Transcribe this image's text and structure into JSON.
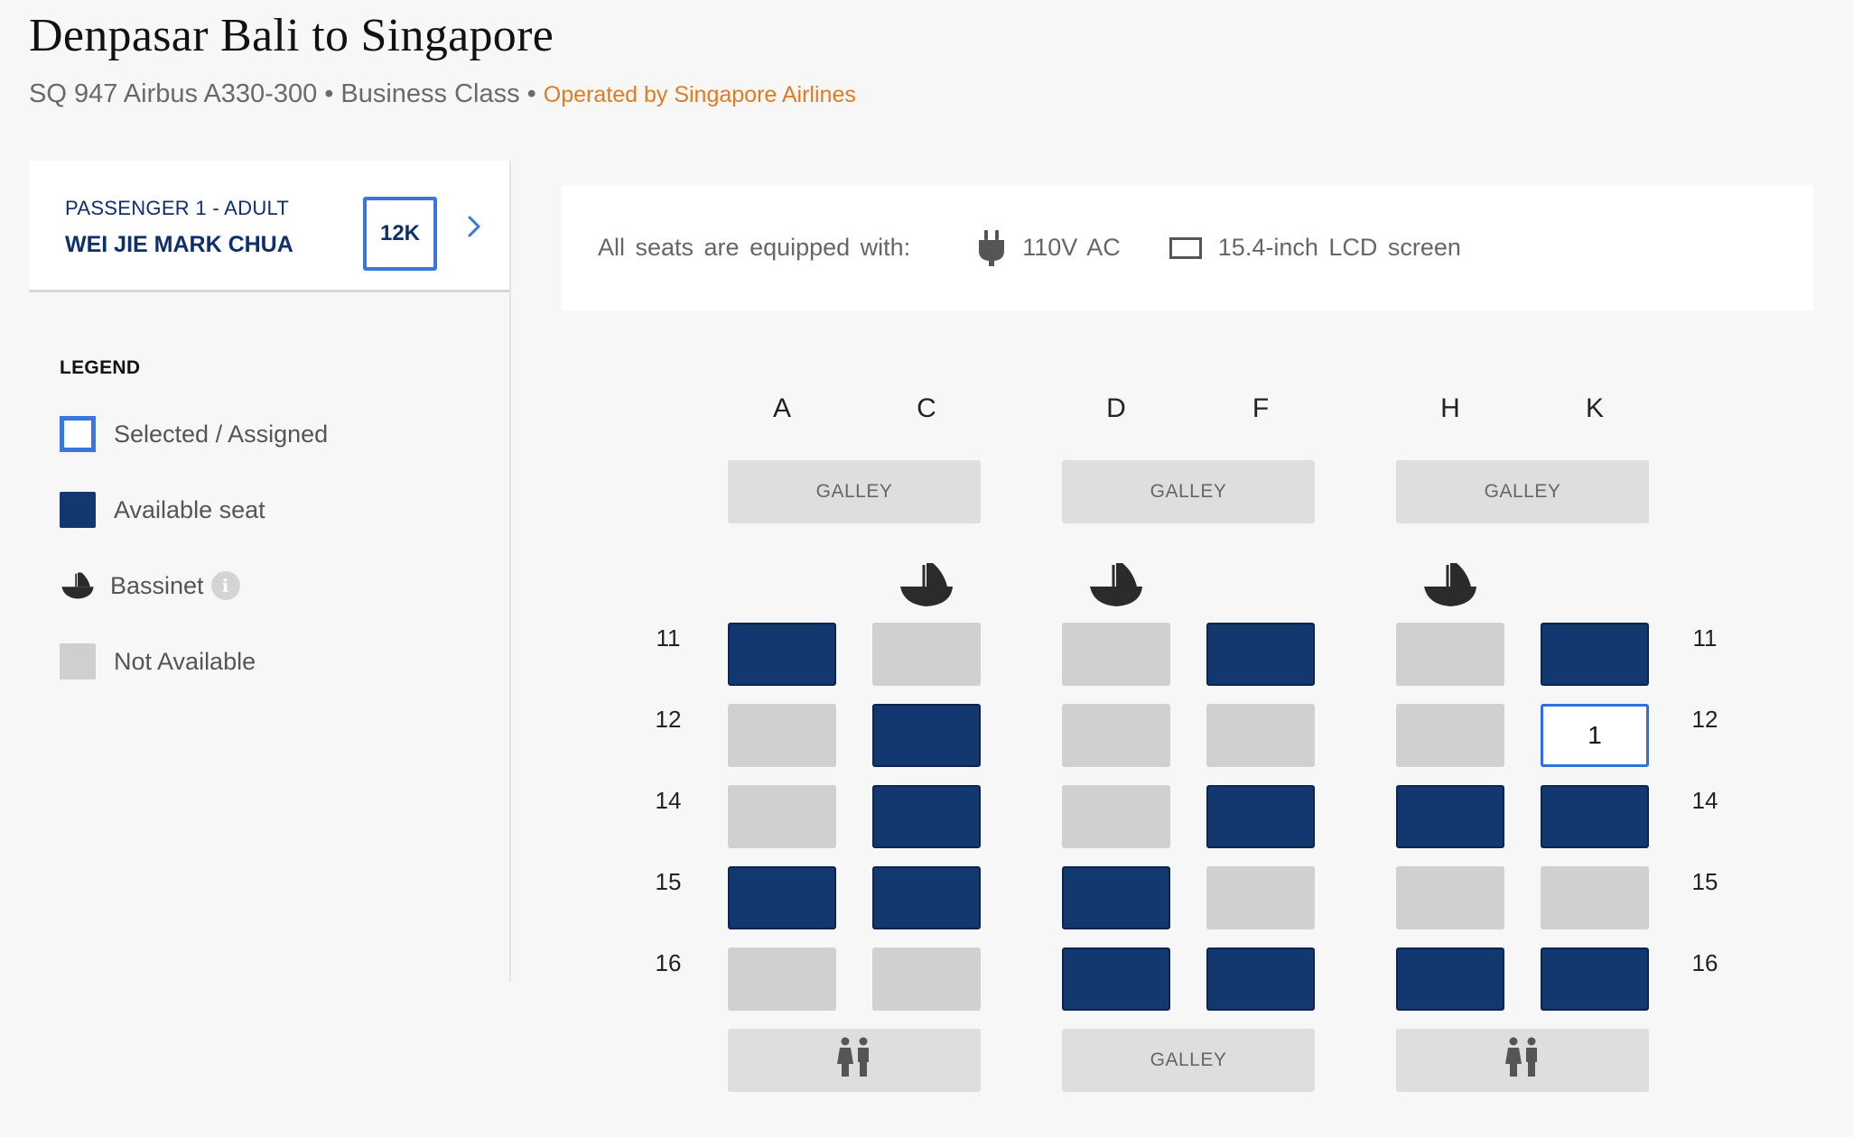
{
  "header": {
    "title": "Denpasar Bali to Singapore",
    "flight": "SQ 947 Airbus A330-300",
    "cabin": "Business Class",
    "separator": "•",
    "operated_by": "Operated by Singapore Airlines"
  },
  "passenger": {
    "label": "PASSENGER 1 - ADULT",
    "name": "WEI JIE MARK CHUA",
    "seat": "12K"
  },
  "legend": {
    "title": "LEGEND",
    "items": [
      {
        "label": "Selected / Assigned",
        "icon": "selected-swatch"
      },
      {
        "label": "Available seat",
        "icon": "available-swatch"
      },
      {
        "label": "Bassinet",
        "icon": "bassinet-icon"
      },
      {
        "label": "Not Available",
        "icon": "not-available-swatch"
      }
    ]
  },
  "amenities": {
    "lead": "All seats are equipped with:",
    "items": [
      {
        "label": "110V AC",
        "icon": "power-plug-icon"
      },
      {
        "label": "15.4-inch LCD screen",
        "icon": "screen-icon"
      }
    ]
  },
  "seatmap": {
    "columns": [
      "A",
      "C",
      "D",
      "F",
      "H",
      "K"
    ],
    "front_facilities": [
      "GALLEY",
      "GALLEY",
      "GALLEY"
    ],
    "rear_facilities": [
      {
        "label": "",
        "icon": "lavatory-icon"
      },
      {
        "label": "GALLEY",
        "icon": ""
      },
      {
        "label": "",
        "icon": "lavatory-icon"
      }
    ],
    "bassinet_columns": [
      "C",
      "D",
      "H"
    ],
    "rows": [
      {
        "number": "11",
        "seats": [
          "available",
          "not-available",
          "not-available",
          "available",
          "not-available",
          "available"
        ]
      },
      {
        "number": "12",
        "seats": [
          "not-available",
          "available",
          "not-available",
          "not-available",
          "not-available",
          "selected"
        ]
      },
      {
        "number": "14",
        "seats": [
          "not-available",
          "available",
          "not-available",
          "available",
          "available",
          "available"
        ]
      },
      {
        "number": "15",
        "seats": [
          "available",
          "available",
          "available",
          "not-available",
          "not-available",
          "not-available"
        ]
      },
      {
        "number": "16",
        "seats": [
          "not-available",
          "not-available",
          "available",
          "available",
          "available",
          "available"
        ]
      }
    ],
    "selected_seat_marker": "1",
    "colors": {
      "available": "#13376f",
      "not_available": "#d0d0d0",
      "selected_border": "#2f6fde",
      "operated_accent": "#e07b22"
    }
  }
}
